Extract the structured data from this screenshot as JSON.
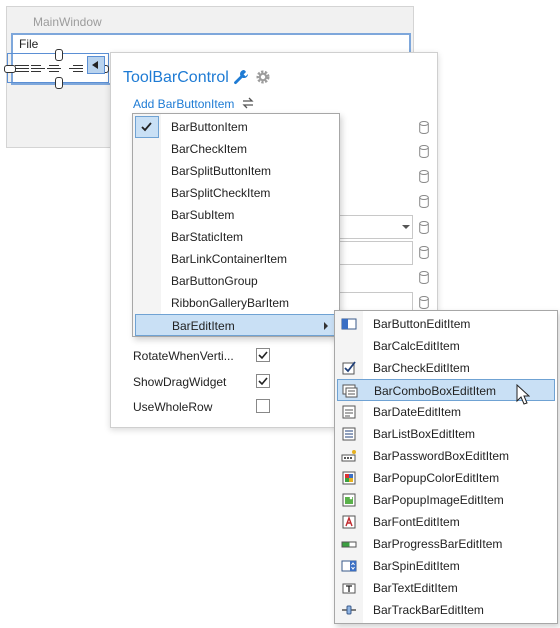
{
  "window": {
    "title": "MainWindow"
  },
  "menubar": {
    "file": "File"
  },
  "panel": {
    "title": "ToolBarControl",
    "add_link": "Add BarButtonItem",
    "properties": [
      {
        "label": "RotateWhenVerti...",
        "checked": true
      },
      {
        "label": "ShowDragWidget",
        "checked": true
      },
      {
        "label": "UseWholeRow",
        "checked": false
      }
    ]
  },
  "add_menu": {
    "items": [
      {
        "label": "BarButtonItem",
        "checked": true
      },
      {
        "label": "BarCheckItem"
      },
      {
        "label": "BarSplitButtonItem"
      },
      {
        "label": "BarSplitCheckItem"
      },
      {
        "label": "BarSubItem"
      },
      {
        "label": "BarStaticItem"
      },
      {
        "label": "BarLinkContainerItem"
      },
      {
        "label": "BarButtonGroup"
      },
      {
        "label": "RibbonGalleryBarItem"
      },
      {
        "label": "BarEditItem",
        "highlighted": true,
        "has_submenu": true
      }
    ]
  },
  "edit_submenu": {
    "items": [
      {
        "label": "BarButtonEditItem",
        "icon": "button-edit-icon"
      },
      {
        "label": "BarCalcEditItem",
        "icon": "none"
      },
      {
        "label": "BarCheckEditItem",
        "icon": "checkbox-icon"
      },
      {
        "label": "BarComboBoxEditItem",
        "icon": "combobox-icon",
        "highlighted": true
      },
      {
        "label": "BarDateEditItem",
        "icon": "date-edit-icon"
      },
      {
        "label": "BarListBoxEditItem",
        "icon": "listbox-icon"
      },
      {
        "label": "BarPasswordBoxEditItem",
        "icon": "password-icon"
      },
      {
        "label": "BarPopupColorEditItem",
        "icon": "color-icon"
      },
      {
        "label": "BarPopupImageEditItem",
        "icon": "image-icon"
      },
      {
        "label": "BarFontEditItem",
        "icon": "font-icon"
      },
      {
        "label": "BarProgressBarEditItem",
        "icon": "progress-icon"
      },
      {
        "label": "BarSpinEditItem",
        "icon": "spin-icon"
      },
      {
        "label": "BarTextEditItem",
        "icon": "text-edit-icon"
      },
      {
        "label": "BarTrackBarEditItem",
        "icon": "trackbar-icon"
      }
    ]
  },
  "colors": {
    "accent": "#1e7bd4",
    "highlight": "#c9e0f5",
    "highlight_border": "#6fa2d3"
  }
}
